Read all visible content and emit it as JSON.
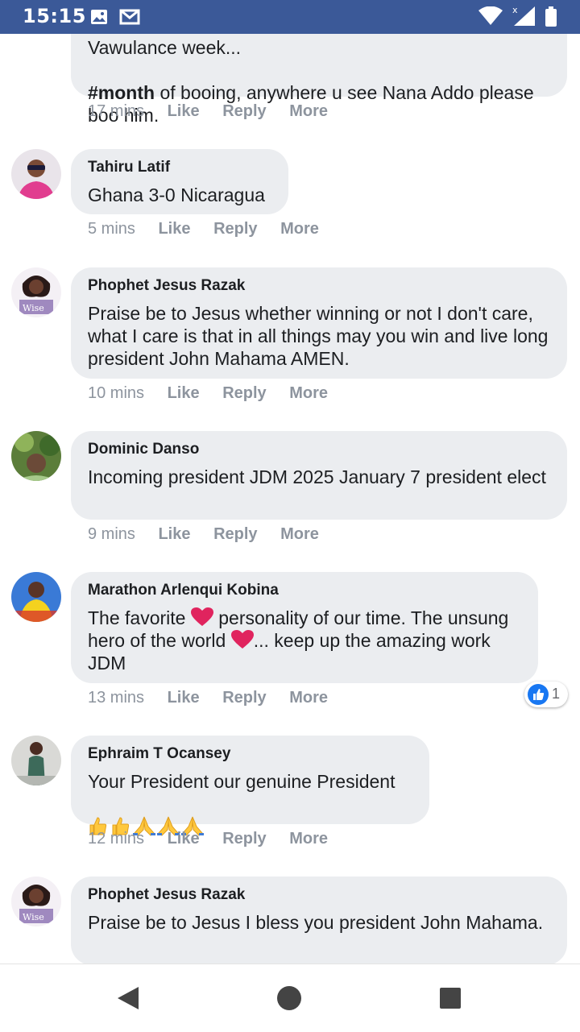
{
  "status_bar": {
    "time": "15:15",
    "icons": [
      "image-icon",
      "gmail-icon",
      "wifi-icon",
      "signal-icon",
      "battery-icon"
    ]
  },
  "comments": [
    {
      "author": "",
      "text_partial_top": "Vawulance week...",
      "text_bold": "#month",
      "text_rest": " of booing, anywhere u see Nana Addo please boo him.",
      "time": "17 mins",
      "like": "Like",
      "reply": "Reply",
      "more": "More"
    },
    {
      "author": "Tahiru Latif",
      "text": "Ghana 3-0 Nicaragua",
      "time": "5 mins",
      "like": "Like",
      "reply": "Reply",
      "more": "More"
    },
    {
      "author": "Phophet Jesus Razak",
      "text": "Praise be to Jesus whether winning or not I don't care, what I care is that in all things may you win and live long president John Mahama AMEN.",
      "time": "10 mins",
      "like": "Like",
      "reply": "Reply",
      "more": "More"
    },
    {
      "author": "Dominic Danso",
      "text": "Incoming president JDM 2025 January 7 president elect",
      "time": "9 mins",
      "like": "Like",
      "reply": "Reply",
      "more": "More"
    },
    {
      "author": "Marathon Arlenqui Kobina",
      "text_part1": "The favorite ",
      "text_part2": " personality of our time. The unsung hero of the world ",
      "text_part3": "... keep up the amazing work JDM",
      "reaction_count": "1",
      "time": "13 mins",
      "like": "Like",
      "reply": "Reply",
      "more": "More"
    },
    {
      "author": "Ephraim T Ocansey",
      "text": "Your President our genuine President",
      "emojis": [
        "thumbs-up",
        "thumbs-up",
        "folded-hands",
        "folded-hands",
        "folded-hands"
      ],
      "time": "12 mins",
      "like": "Like",
      "reply": "Reply",
      "more": "More"
    },
    {
      "author": "Phophet Jesus Razak",
      "text": "Praise be to Jesus I bless you president John Mahama."
    }
  ],
  "colors": {
    "status_bar": "#3b5998",
    "bubble": "#ebedf0",
    "meta_text": "#8d949e",
    "like_blue": "#1877f2",
    "heart_red": "#e0245e"
  }
}
